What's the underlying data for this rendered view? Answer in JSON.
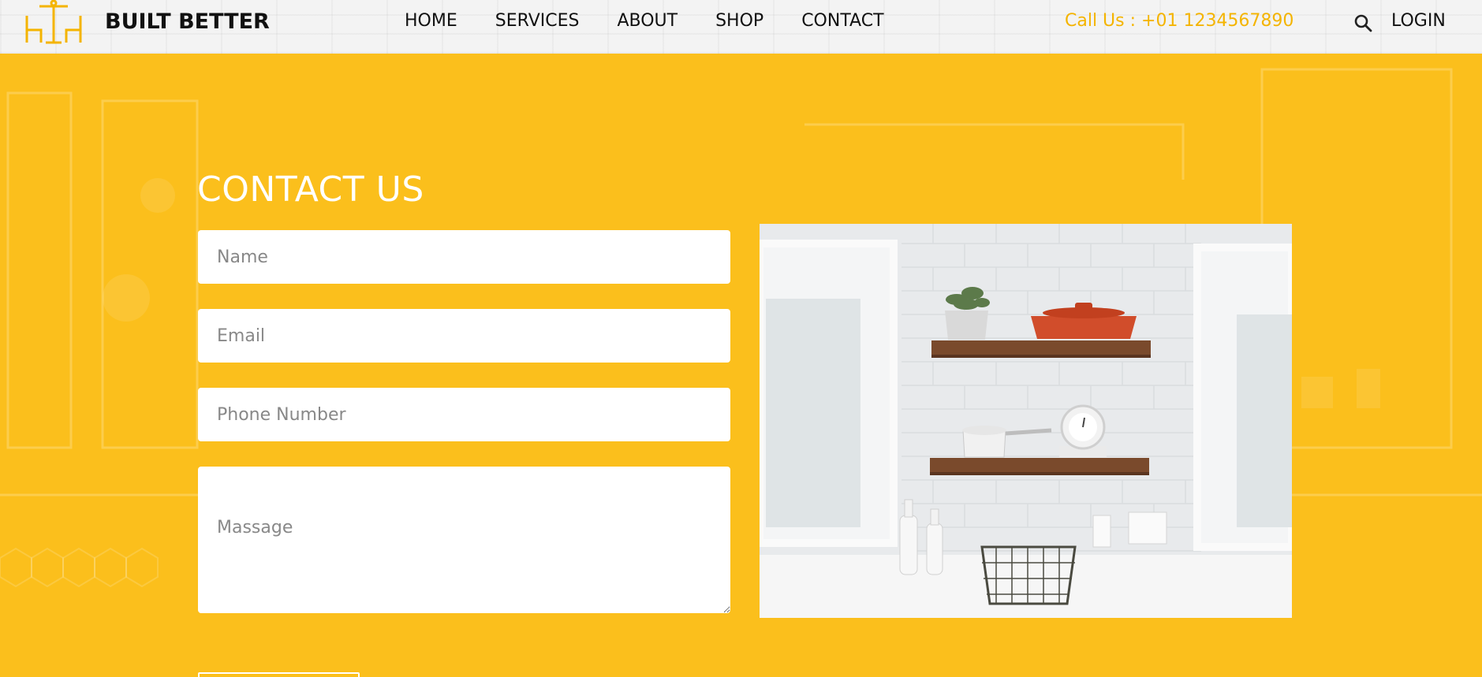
{
  "header": {
    "brand": "BUILT BETTER",
    "nav": [
      "HOME",
      "SERVICES",
      "ABOUT",
      "SHOP",
      "CONTACT"
    ],
    "call": "Call Us : +01 1234567890",
    "login": "LOGIN",
    "icons": {
      "logo": "furniture-logo-icon",
      "search": "search-icon"
    }
  },
  "contact": {
    "title": "CONTACT US",
    "name_placeholder": "Name",
    "email_placeholder": "Email",
    "phone_placeholder": "Phone Number",
    "message_placeholder": "Massage"
  },
  "colors": {
    "accent": "#ffc21f",
    "call_text": "#f4b400",
    "header_bg": "#f3f3f3"
  }
}
